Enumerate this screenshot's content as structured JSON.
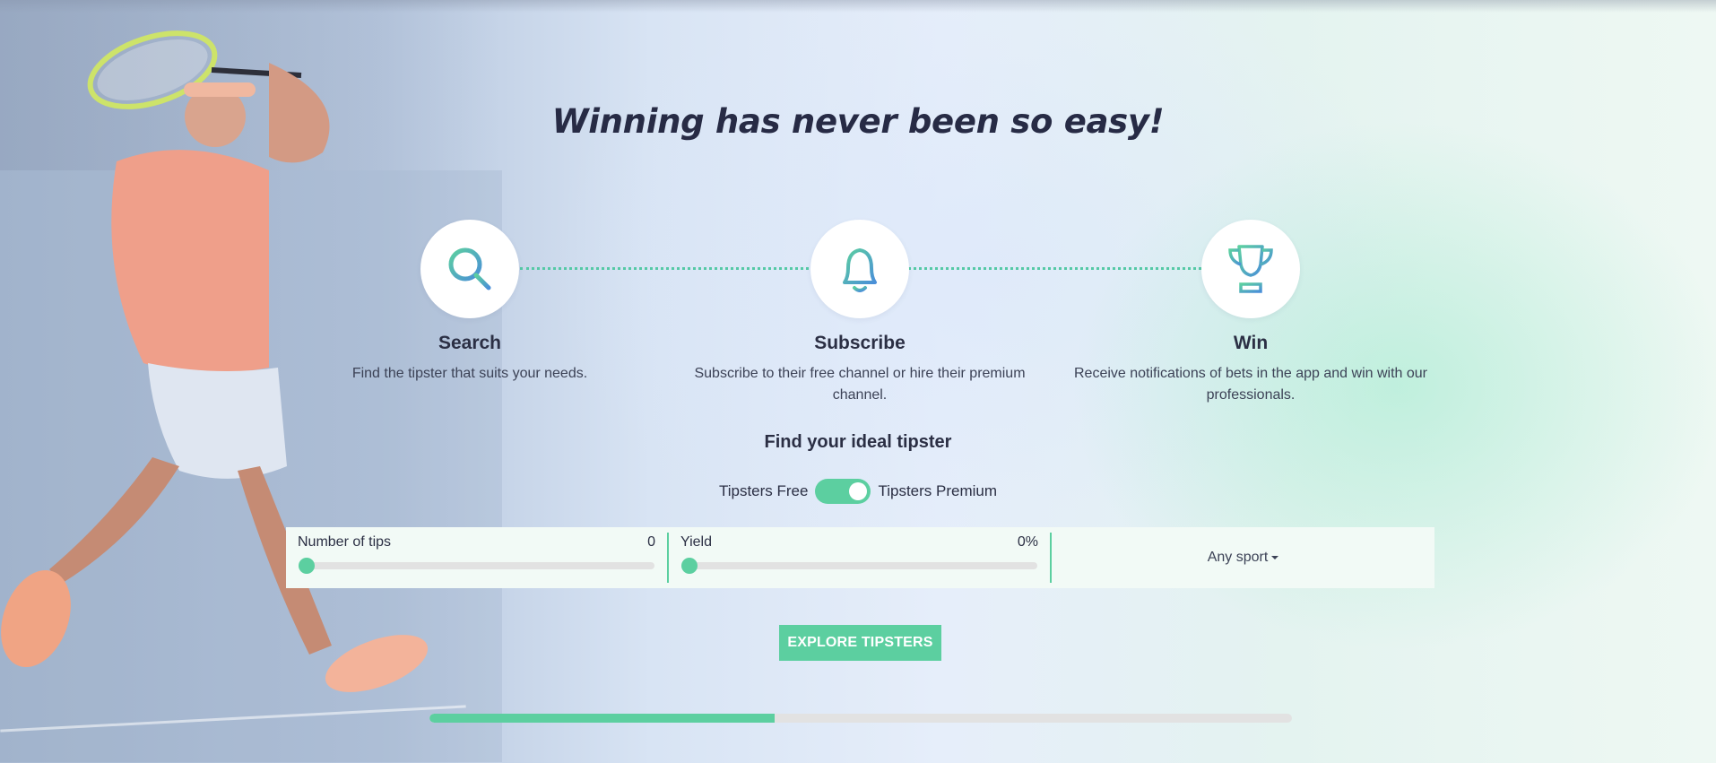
{
  "headline": "Winning has never been so easy!",
  "steps": [
    {
      "icon": "search-icon",
      "title": "Search",
      "description": "Find the tipster that suits your needs."
    },
    {
      "icon": "bell-icon",
      "title": "Subscribe",
      "description": "Subscribe to their free channel or hire their premium channel."
    },
    {
      "icon": "trophy-icon",
      "title": "Win",
      "description": "Receive notifications of bets in the app and win with our professionals."
    }
  ],
  "finder": {
    "title": "Find your ideal tipster",
    "toggle_left": "Tipsters Free",
    "toggle_right": "Tipsters Premium",
    "toggle_on": true
  },
  "filters": {
    "tips": {
      "label": "Number of tips",
      "value": "0",
      "level": 0
    },
    "yield": {
      "label": "Yield",
      "value": "0%",
      "level": 0
    },
    "sport": {
      "label": "Any sport"
    }
  },
  "explore_button": "EXPLORE TIPSTERS",
  "carousel_progress": 0.4,
  "colors": {
    "accent": "#5ccfa0",
    "text": "#2b2f44",
    "icon_gradient_start": "#5ccfa0",
    "icon_gradient_end": "#4a8fd8"
  }
}
